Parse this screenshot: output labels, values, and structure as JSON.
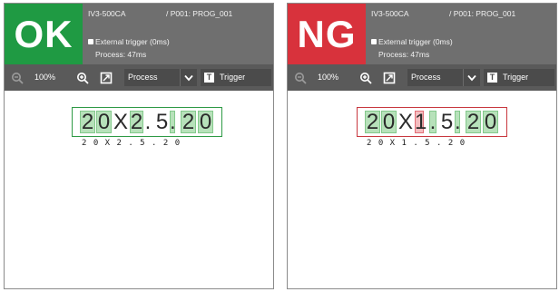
{
  "panels": [
    {
      "status": "OK",
      "status_color": "#1f9a43",
      "model": "IV3-500CA",
      "program": "/ P001: PROG_001",
      "trigger_text": "External trigger (0ms)",
      "process_text": "Process: 47ms",
      "zoom": "100%",
      "process_btn": "Process",
      "trigger_btn": "Trigger",
      "ocr_chars": [
        "2",
        "0",
        "X",
        "2",
        ".",
        "5",
        ".",
        "2",
        "0"
      ],
      "ocr_sub": "2 0 X 2 .  5 .  2 0",
      "bad_index": -1
    },
    {
      "status": "NG",
      "status_color": "#d8323c",
      "model": "IV3-500CA",
      "program": "/ P001: PROG_001",
      "trigger_text": "External trigger (0ms)",
      "process_text": "Process: 47ms",
      "zoom": "100%",
      "process_btn": "Process",
      "trigger_btn": "Trigger",
      "ocr_chars": [
        "2",
        "0",
        "X",
        "1",
        ".",
        "5",
        ".",
        "2",
        "0"
      ],
      "ocr_sub": "2 0 X 1 .  5 .  2 0",
      "bad_index": 3
    }
  ],
  "icons": [
    "zoom-out-icon",
    "zoom-in-icon",
    "fit-icon",
    "chevron-down-icon",
    "trigger-t-icon"
  ]
}
